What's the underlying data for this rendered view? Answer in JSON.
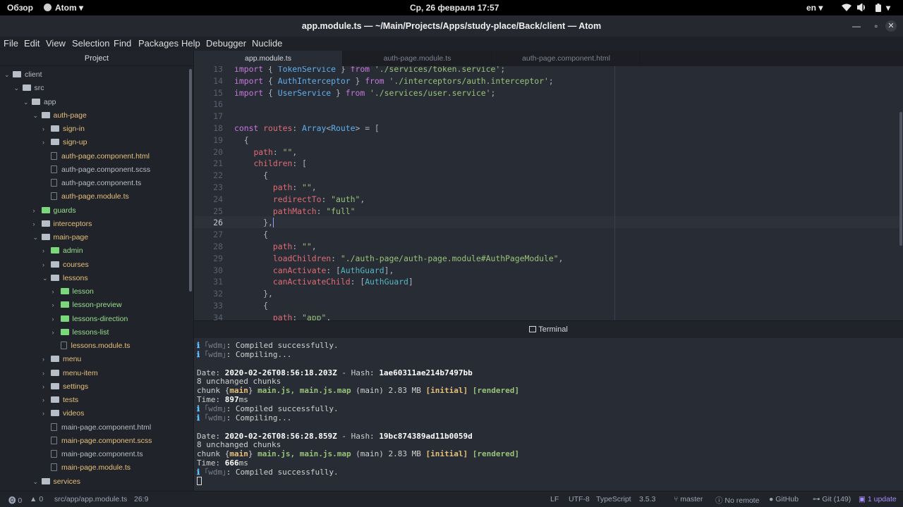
{
  "system": {
    "overview": "Обзор",
    "app_menu": "Atom",
    "datetime": "Ср, 26 февраля  17:57",
    "lang": "en"
  },
  "window": {
    "title": "app.module.ts — ~/Main/Projects/Apps/study-place/Back/client — Atom"
  },
  "menu": [
    "File",
    "Edit",
    "View",
    "Selection",
    "Find",
    "Packages",
    "Help",
    "Debugger",
    "Nuclide"
  ],
  "tree": {
    "title": "Project",
    "items": [
      {
        "label": "client",
        "type": "folder-open",
        "depth": 0,
        "status": "normal"
      },
      {
        "label": "src",
        "type": "folder-open",
        "depth": 1,
        "status": "normal"
      },
      {
        "label": "app",
        "type": "folder-open",
        "depth": 2,
        "status": "normal"
      },
      {
        "label": "auth-page",
        "type": "folder-open",
        "depth": 3,
        "status": "modified"
      },
      {
        "label": "sign-in",
        "type": "folder",
        "depth": 4,
        "status": "modified"
      },
      {
        "label": "sign-up",
        "type": "folder",
        "depth": 4,
        "status": "modified"
      },
      {
        "label": "auth-page.component.html",
        "type": "file",
        "depth": 4,
        "status": "modified"
      },
      {
        "label": "auth-page.component.scss",
        "type": "file",
        "depth": 4,
        "status": "normal"
      },
      {
        "label": "auth-page.component.ts",
        "type": "file",
        "depth": 4,
        "status": "normal"
      },
      {
        "label": "auth-page.module.ts",
        "type": "file",
        "depth": 4,
        "status": "modified"
      },
      {
        "label": "guards",
        "type": "folder",
        "depth": 3,
        "status": "new"
      },
      {
        "label": "interceptors",
        "type": "folder",
        "depth": 3,
        "status": "modified"
      },
      {
        "label": "main-page",
        "type": "folder-open",
        "depth": 3,
        "status": "modified"
      },
      {
        "label": "admin",
        "type": "folder",
        "depth": 4,
        "status": "new"
      },
      {
        "label": "courses",
        "type": "folder",
        "depth": 4,
        "status": "modified"
      },
      {
        "label": "lessons",
        "type": "folder-open",
        "depth": 4,
        "status": "modified"
      },
      {
        "label": "lesson",
        "type": "folder",
        "depth": 5,
        "status": "new"
      },
      {
        "label": "lesson-preview",
        "type": "folder",
        "depth": 5,
        "status": "new"
      },
      {
        "label": "lessons-direction",
        "type": "folder",
        "depth": 5,
        "status": "new"
      },
      {
        "label": "lessons-list",
        "type": "folder",
        "depth": 5,
        "status": "new"
      },
      {
        "label": "lessons.module.ts",
        "type": "file",
        "depth": 5,
        "status": "modified"
      },
      {
        "label": "menu",
        "type": "folder",
        "depth": 4,
        "status": "modified"
      },
      {
        "label": "menu-item",
        "type": "folder",
        "depth": 4,
        "status": "modified"
      },
      {
        "label": "settings",
        "type": "folder",
        "depth": 4,
        "status": "modified"
      },
      {
        "label": "tests",
        "type": "folder",
        "depth": 4,
        "status": "modified"
      },
      {
        "label": "videos",
        "type": "folder",
        "depth": 4,
        "status": "modified"
      },
      {
        "label": "main-page.component.html",
        "type": "file",
        "depth": 4,
        "status": "normal"
      },
      {
        "label": "main-page.component.scss",
        "type": "file",
        "depth": 4,
        "status": "modified"
      },
      {
        "label": "main-page.component.ts",
        "type": "file",
        "depth": 4,
        "status": "normal"
      },
      {
        "label": "main-page.module.ts",
        "type": "file",
        "depth": 4,
        "status": "modified"
      },
      {
        "label": "services",
        "type": "folder-open",
        "depth": 3,
        "status": "modified"
      }
    ]
  },
  "tabs": [
    "app.module.ts",
    "auth-page.module.ts",
    "auth-page.component.html"
  ],
  "editor": {
    "current_line": "26",
    "lines": [
      {
        "n": "13",
        "t": "import { TokenService } from './services/token.service';"
      },
      {
        "n": "14",
        "t": "import { AuthInterceptor } from './interceptors/auth.interceptor';"
      },
      {
        "n": "15",
        "t": "import { UserService } from './services/user.service';"
      },
      {
        "n": "16",
        "t": ""
      },
      {
        "n": "17",
        "t": ""
      },
      {
        "n": "18",
        "t": "const routes: Array<Route> = ["
      },
      {
        "n": "19",
        "t": "  {"
      },
      {
        "n": "20",
        "t": "    path: \"\","
      },
      {
        "n": "21",
        "t": "    children: ["
      },
      {
        "n": "22",
        "t": "      {"
      },
      {
        "n": "23",
        "t": "        path: \"\","
      },
      {
        "n": "24",
        "t": "        redirectTo: \"auth\","
      },
      {
        "n": "25",
        "t": "        pathMatch: \"full\""
      },
      {
        "n": "26",
        "t": "      },"
      },
      {
        "n": "27",
        "t": "      {"
      },
      {
        "n": "28",
        "t": "        path: \"\","
      },
      {
        "n": "29",
        "t": "        loadChildren: \"./auth-page/auth-page.module#AuthPageModule\","
      },
      {
        "n": "30",
        "t": "        canActivate: [AuthGuard],"
      },
      {
        "n": "31",
        "t": "        canActivateChild: [AuthGuard]"
      },
      {
        "n": "32",
        "t": "      },"
      },
      {
        "n": "33",
        "t": "      {"
      },
      {
        "n": "34",
        "t": "        path: \"app\","
      }
    ]
  },
  "terminal": {
    "title": "Terminal",
    "lines": [
      {
        "i": "ℹ",
        "w": "｢wdm｣",
        "rest": ": Compiled successfully."
      },
      {
        "i": "ℹ",
        "w": "｢wdm｣",
        "rest": ": Compiling..."
      },
      {
        "blank": true
      },
      {
        "date_label": "Date: ",
        "date": "2020-02-26T08:56:18.203Z",
        "hash_label": " - Hash: ",
        "hash": "1ae60311ae214b7497bb"
      },
      {
        "plain": "8 unchanged chunks"
      },
      {
        "chunk": true,
        "a": "chunk {",
        "m": "main",
        "b": "} ",
        "files": "main.js, main.js.map",
        "c": " (main) 2.83 MB ",
        "init": "[initial]",
        "sp": " ",
        "rend": "[rendered]"
      },
      {
        "time_label": "Time: ",
        "ms": "897",
        "unit": "ms"
      },
      {
        "i": "ℹ",
        "w": "｢wdm｣",
        "rest": ": Compiled successfully."
      },
      {
        "i": "ℹ",
        "w": "｢wdm｣",
        "rest": ": Compiling..."
      },
      {
        "blank": true
      },
      {
        "date_label": "Date: ",
        "date": "2020-02-26T08:56:28.859Z",
        "hash_label": " - Hash: ",
        "hash": "19bc874389ad11b0059d"
      },
      {
        "plain": "8 unchanged chunks"
      },
      {
        "chunk": true,
        "a": "chunk {",
        "m": "main",
        "b": "} ",
        "files": "main.js, main.js.map",
        "c": " (main) 2.83 MB ",
        "init": "[initial]",
        "sp": " ",
        "rend": "[rendered]"
      },
      {
        "time_label": "Time: ",
        "ms": "666",
        "unit": "ms"
      },
      {
        "i": "ℹ",
        "w": "｢wdm｣",
        "rest": ": Compiled successfully."
      }
    ]
  },
  "status": {
    "errors": "0",
    "warnings": "0",
    "path": "src/app/app.module.ts",
    "cursor": "26:9",
    "eol": "LF",
    "encoding": "UTF-8",
    "grammar": "TypeScript",
    "version": "3.5.3",
    "branch": "master",
    "remote": "No remote",
    "github": "GitHub",
    "git": "Git (149)",
    "update": "1 update"
  }
}
